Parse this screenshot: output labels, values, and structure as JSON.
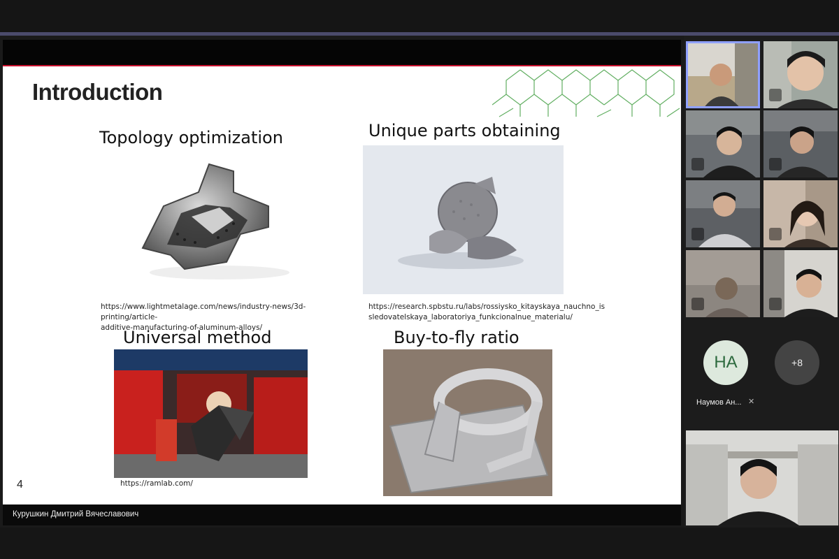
{
  "slide": {
    "title": "Introduction",
    "number": "4",
    "items": [
      {
        "caption": "Topology optimization",
        "url": "https://www.lightmetalage.com/news/industry-news/3d-printing/article-additive-manufacturing-of-aluminum-alloys/"
      },
      {
        "caption": "Unique parts obtaining",
        "url": "https://research.spbstu.ru/labs/rossiysko_kitayskaya_nauchno_issledovatelskaya_laboratoriya_funkcionalnue_materialu/"
      },
      {
        "caption": "Universal method",
        "url": "https://ramlab.com/"
      },
      {
        "caption": "Buy-to-fly ratio",
        "url": ""
      }
    ],
    "url_lines": {
      "topology_1": "https://www.lightmetalage.com/news/industry-news/3d-printing/article-",
      "topology_2": "additive-manufacturing-of-aluminum-alloys/",
      "unique_1": "https://research.spbstu.ru/labs/rossiysko_kitayskaya_nauchno_is",
      "unique_2": "sledovatelskaya_laboratoriya_funkcionalnue_materialu/"
    }
  },
  "speaker": {
    "name": "Курушкин Дмитрий Вячеславович"
  },
  "participants": {
    "avatar_initials": "HA",
    "avatar_name": "Наумов Ан...",
    "more_count": "+8"
  },
  "colors": {
    "slide_accent": "#c8102e",
    "deco_green": "#3a9a3a",
    "avatar_bg": "#dde9dd",
    "avatar_text": "#2d6a3e",
    "more_bg": "#444444",
    "active_outline": "#8fa0ff"
  },
  "icons": [
    "mic-off-icon"
  ]
}
